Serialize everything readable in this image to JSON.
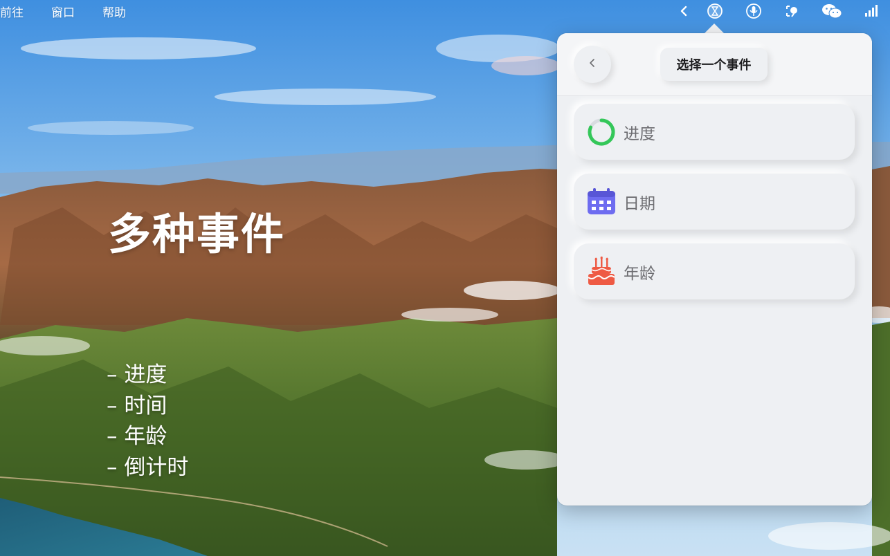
{
  "menubar": {
    "items": [
      "前往",
      "窗口",
      "帮助"
    ],
    "status_icons": [
      "chevron-left-icon",
      "hourglass-icon",
      "mic-icon",
      "screen-capture-icon",
      "wechat-icon",
      "signal-bars-icon"
    ]
  },
  "promo": {
    "headline": "多种事件",
    "features": [
      "– 进度",
      "– 时间",
      "– 年龄",
      "– 倒计时"
    ]
  },
  "popover": {
    "title": "选择一个事件",
    "back_icon": "chevron-left-icon",
    "events": [
      {
        "label": "进度",
        "icon": "progress-ring-icon",
        "color": "#34c759"
      },
      {
        "label": "日期",
        "icon": "calendar-icon",
        "color": "#6e6cf0"
      },
      {
        "label": "年龄",
        "icon": "birthday-cake-icon",
        "color": "#ee5a44"
      }
    ]
  }
}
